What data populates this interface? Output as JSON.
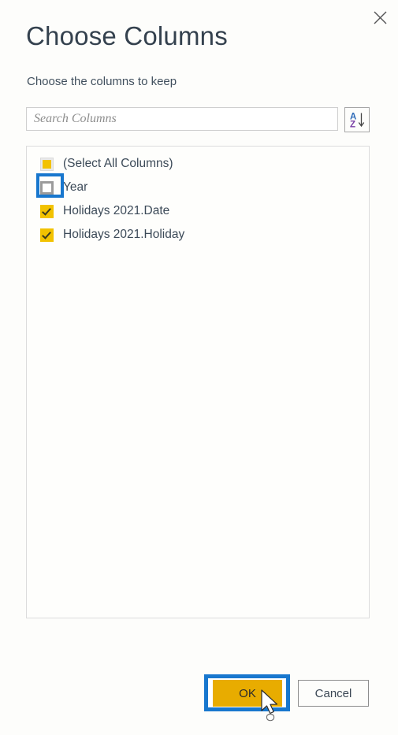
{
  "dialog": {
    "title": "Choose Columns",
    "subtitle": "Choose the columns to keep",
    "close_label": "Close"
  },
  "search": {
    "placeholder": "Search Columns",
    "value": "",
    "sort_button_label": "Sort A to Z"
  },
  "columns": [
    {
      "label": "(Select All Columns)",
      "state": "indeterminate",
      "highlighted": false
    },
    {
      "label": "Year",
      "state": "unchecked",
      "highlighted": true
    },
    {
      "label": "Holidays 2021.Date",
      "state": "checked",
      "highlighted": false
    },
    {
      "label": "Holidays 2021.Holiday",
      "state": "checked",
      "highlighted": false
    }
  ],
  "footer": {
    "ok_label": "OK",
    "cancel_label": "Cancel"
  },
  "colors": {
    "accent_gold": "#e8ac00",
    "checkbox_gold": "#f2c200",
    "annotation_blue": "#1877ce",
    "text_dark": "#3c4a58",
    "border_grey": "#cfcfcf",
    "background": "#fdfdfb"
  }
}
